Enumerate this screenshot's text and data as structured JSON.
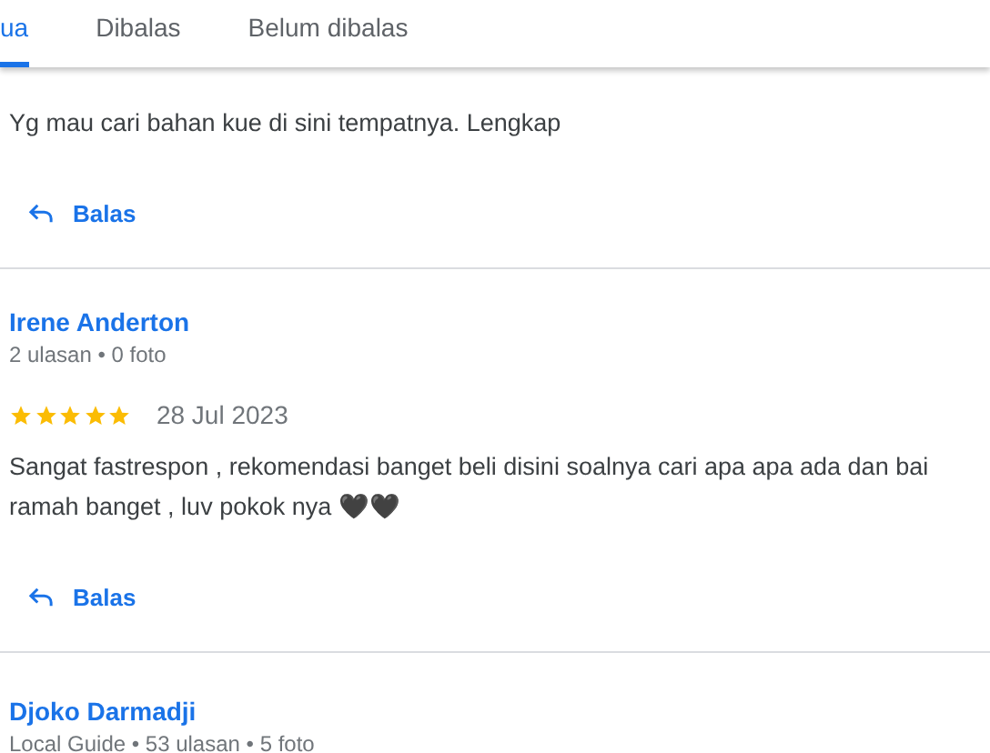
{
  "tabs": [
    {
      "label": "ua",
      "selected": true
    },
    {
      "label": "Dibalas",
      "selected": false
    },
    {
      "label": "Belum dibalas",
      "selected": false
    }
  ],
  "reviews": [
    {
      "text": "Yg mau cari bahan kue di sini tempatnya. Lengkap",
      "reply": "Balas"
    },
    {
      "name": "Irene Anderton",
      "meta": "2 ulasan • 0 foto",
      "stars": 5,
      "date": "28 Jul 2023",
      "text": "Sangat fastrespon , rekomendasi banget beli disini soalnya cari apa apa ada dan bai\nramah banget , luv pokok nya 🖤🖤",
      "reply": "Balas"
    },
    {
      "name": "Djoko Darmadji",
      "meta": "Local Guide • 53 ulasan • 5 foto"
    }
  ]
}
